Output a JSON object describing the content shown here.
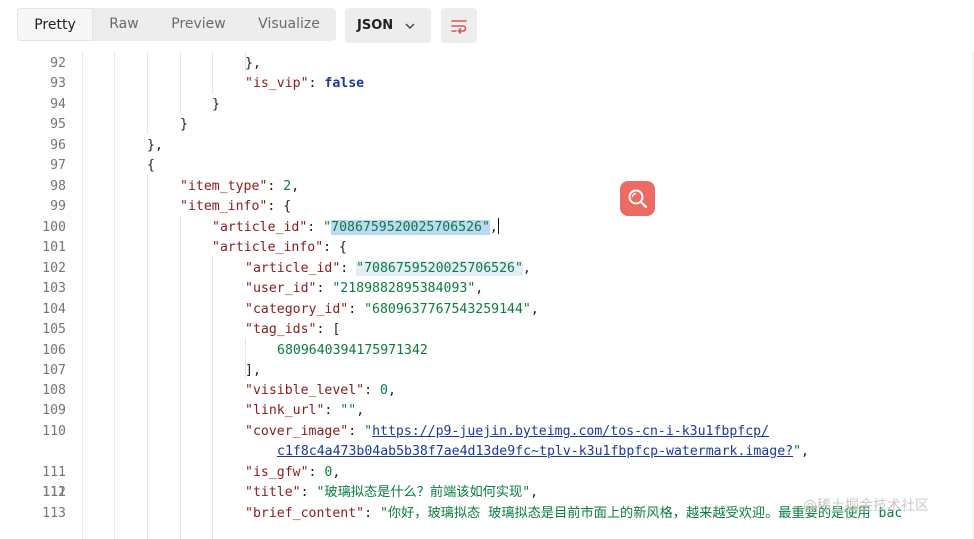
{
  "toolbar": {
    "tabs": [
      {
        "label": "Pretty",
        "active": true
      },
      {
        "label": "Raw",
        "active": false
      },
      {
        "label": "Preview",
        "active": false
      },
      {
        "label": "Visualize",
        "active": false
      }
    ],
    "format_label": "JSON",
    "format_icon": "chevron-down-icon",
    "wrap_icon": "wrap-lines-icon",
    "accent_color": "#ee6b64"
  },
  "editor": {
    "line_numbers": [
      "92",
      "93",
      "94",
      "95",
      "96",
      "97",
      "98",
      "99",
      "100",
      "101",
      "102",
      "103",
      "104",
      "105",
      "106",
      "107",
      "108",
      "109",
      "110",
      "",
      "111",
      "112",
      "113"
    ],
    "tokens": {
      "l92": "},",
      "l93_key": "\"is_vip\"",
      "l93_val": "false",
      "l94": "}",
      "l95": "}",
      "l96": "},",
      "l97": "{",
      "l98_key": "\"item_type\"",
      "l98_val": "2",
      "l99_key": "\"item_info\"",
      "l100_key": "\"article_id\"",
      "l100_val": "\"7086759520025706526\"",
      "l101_key": "\"article_info\"",
      "l102_key": "\"article_id\"",
      "l102_val": "\"7086759520025706526\"",
      "l103_key": "\"user_id\"",
      "l103_val": "\"2189882895384093\"",
      "l104_key": "\"category_id\"",
      "l104_val": "\"6809637767543259144\"",
      "l105_key": "\"tag_ids\"",
      "l106_val": "6809640394175971342",
      "l107": "],",
      "l108_key": "\"visible_level\"",
      "l108_val": "0",
      "l109_key": "\"link_url\"",
      "l109_val": "\"\"",
      "l110_key": "\"cover_image\"",
      "l110_url1": "https://p9-juejin.byteimg.com/tos-cn-i-k3u1fbpfcp/",
      "l110_url2": "c1f8c4a473b04ab5b38f7ae4d13de9fc~tplv-k3u1fbpfcp-watermark.image?",
      "l111_key": "\"is_gfw\"",
      "l111_val": "0",
      "l112_key": "\"title\"",
      "l112_val": "\"玻璃拟态是什么？前端该如何实现\"",
      "l113_key": "\"brief_content\"",
      "l113_val": "\"你好，玻璃拟态 玻璃拟态是目前市面上的新风格，越来越受欢迎。最重要的是使用 bac"
    },
    "search_icon": "search-icon"
  },
  "watermark": "@稀土掘金技术社区"
}
